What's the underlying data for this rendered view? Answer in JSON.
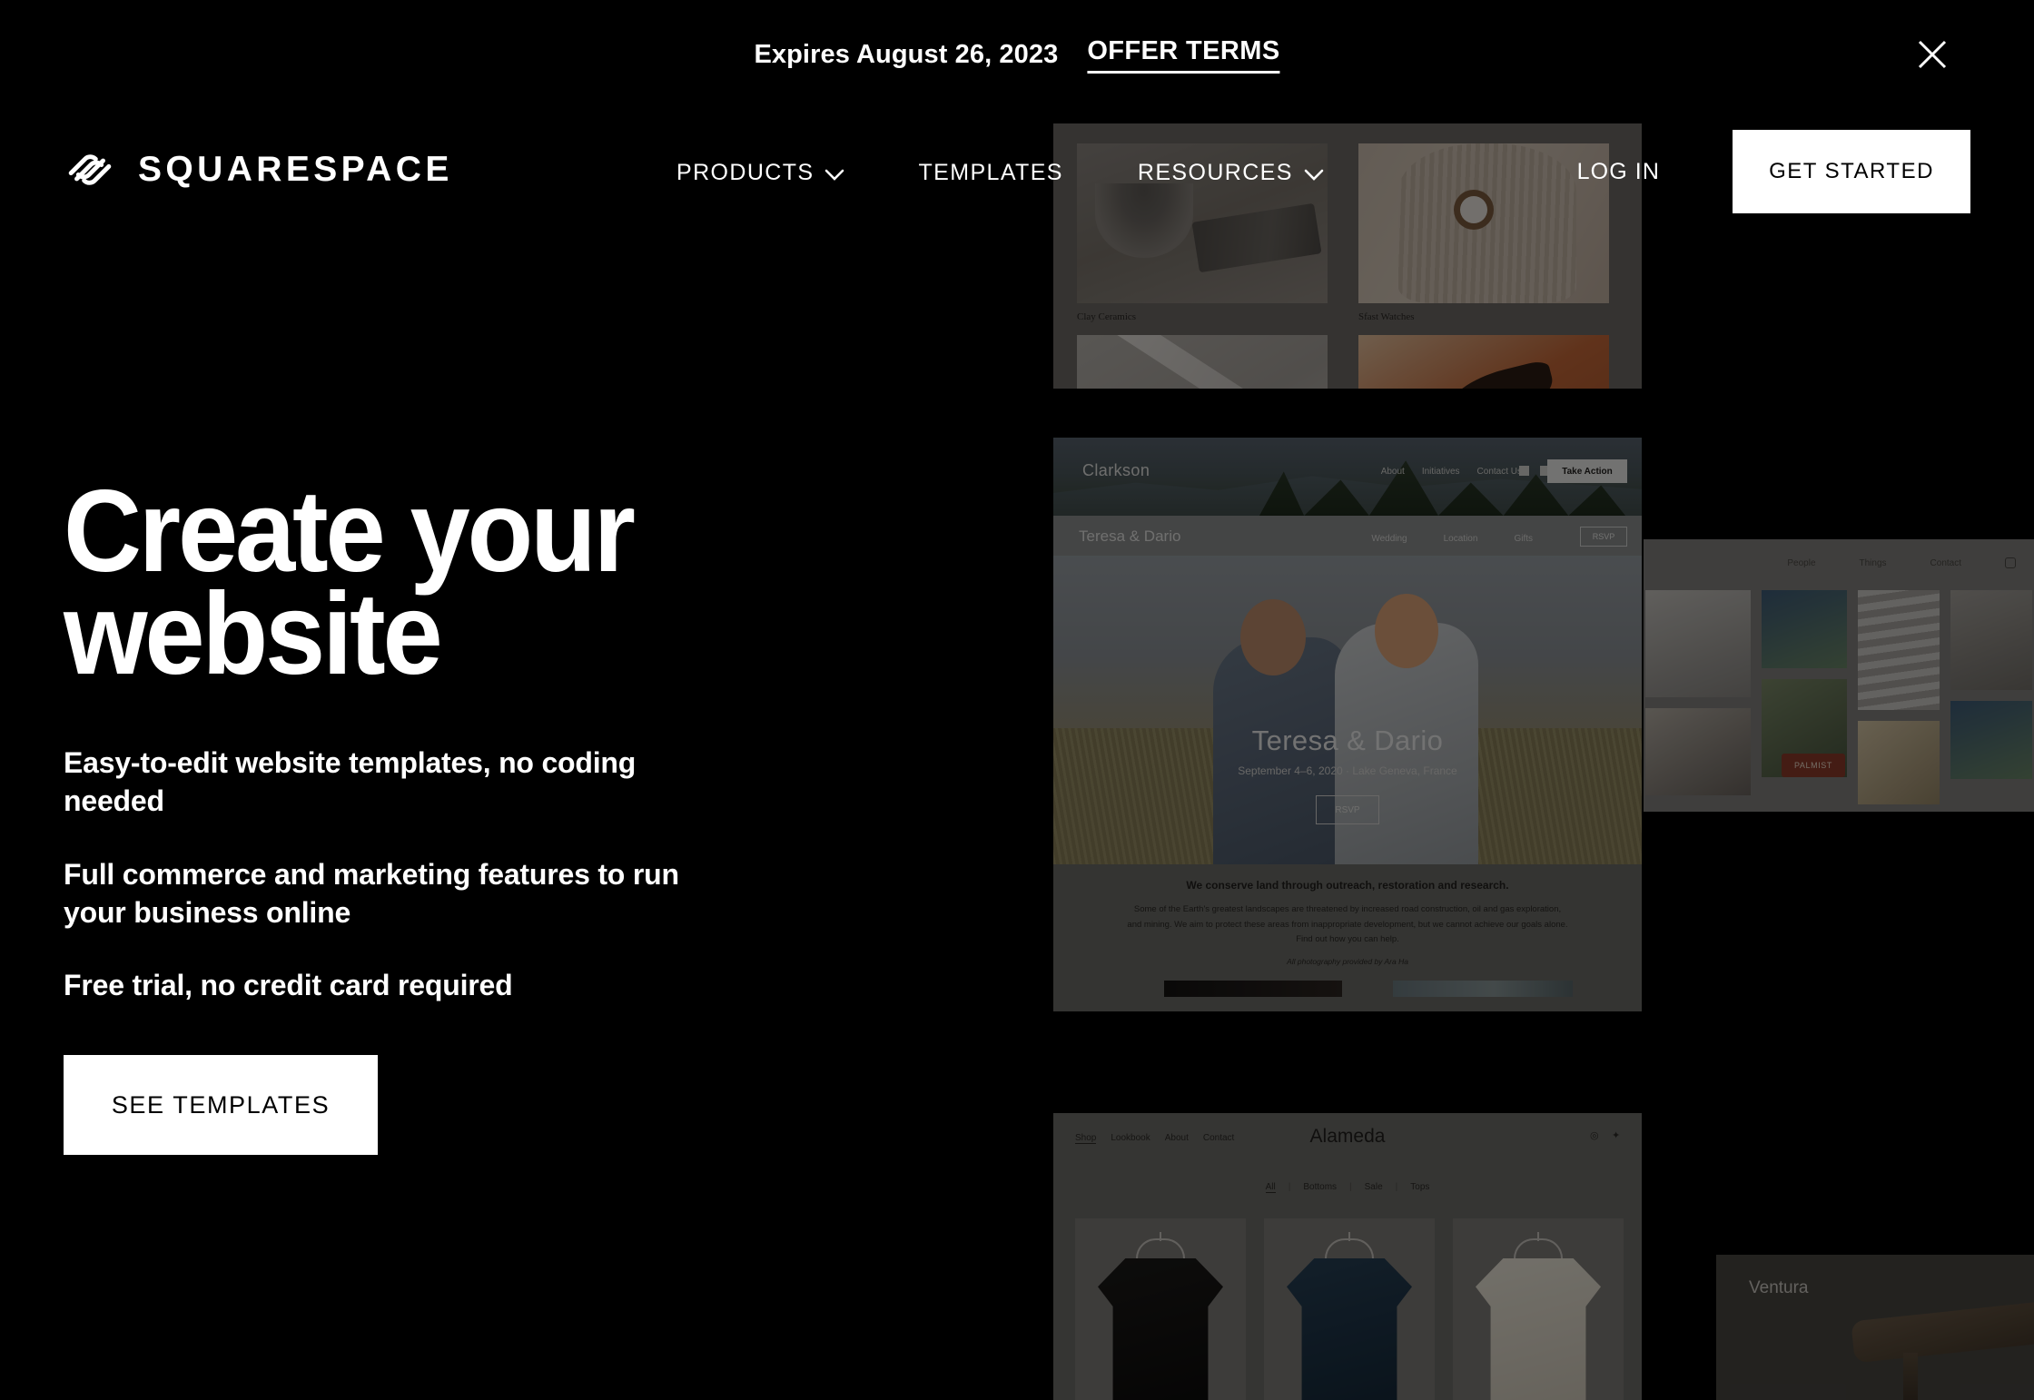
{
  "promo": {
    "expires": "Expires August 26, 2023",
    "terms_label": "OFFER TERMS",
    "close_icon": "close-icon"
  },
  "header": {
    "logo_text": "SQUARESPACE",
    "logo_mark": "squarespace-logo-icon",
    "nav": [
      {
        "label": "PRODUCTS",
        "has_chevron": true
      },
      {
        "label": "TEMPLATES",
        "has_chevron": false
      },
      {
        "label": "RESOURCES",
        "has_chevron": true
      }
    ],
    "login_label": "LOG IN",
    "get_started_label": "GET STARTED"
  },
  "hero": {
    "title_line1": "Create your",
    "title_line2": "website",
    "bullets": [
      "Easy-to-edit website templates, no coding needed",
      "Full commerce and marketing features to run your business online",
      "Free trial, no credit card required"
    ],
    "cta_label": "SEE TEMPLATES"
  },
  "templates": {
    "products_card": {
      "items": [
        {
          "label": "Clay Ceramics"
        },
        {
          "label": "Sfast Watches"
        },
        {
          "label": ""
        },
        {
          "label": ""
        }
      ]
    },
    "clarkson_card": {
      "brand": "Clarkson",
      "nav": [
        "About",
        "Initiatives",
        "Contact Us"
      ],
      "social": [
        "twitter-icon",
        "linkedin-icon",
        "facebook-icon"
      ],
      "cta_label": "Take Action",
      "wedding": {
        "brand": "Teresa & Dario",
        "nav": [
          "Wedding",
          "Location",
          "Gifts"
        ],
        "rsvp_label": "RSVP",
        "hero_title": "Teresa & Dario",
        "hero_subtitle": "September 4–6, 2020 · Lake Geneva, France",
        "hero_button": "RSVP"
      },
      "headline": "We conserve land through outreach, restoration and research.",
      "paragraph": "Some of the Earth's greatest landscapes are threatened by increased road construction, oil and gas exploration, and mining. We aim to protect these areas from inappropriate development, but we cannot achieve our goals alone. Find out how you can help.",
      "credit": "All photography provided by Ara Ha"
    },
    "photos_card": {
      "nav": [
        "People",
        "Things",
        "Contact"
      ],
      "icon": "instagram-icon",
      "badge": "PALMIST"
    },
    "alameda_card": {
      "brand": "Alameda",
      "nav": [
        "Shop",
        "Lookbook",
        "About",
        "Contact"
      ],
      "icons": [
        "instagram-icon",
        "twitter-icon"
      ],
      "filters": [
        "All",
        "Bottoms",
        "Sale",
        "Tops"
      ],
      "separator": "|"
    },
    "ventura_card": {
      "brand": "Ventura"
    }
  },
  "colors": {
    "background": "#000000",
    "text": "#ffffff",
    "button_bg": "#ffffff",
    "button_text": "#000000"
  }
}
